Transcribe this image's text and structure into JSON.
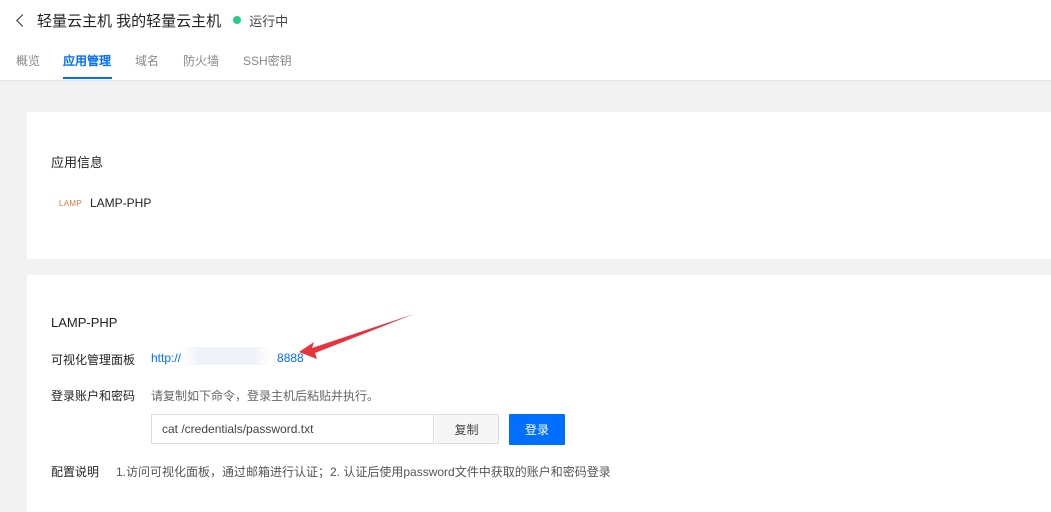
{
  "header": {
    "title": "轻量云主机 我的轻量云主机",
    "status": "运行中",
    "status_color": "#29cc85"
  },
  "tabs": [
    {
      "label": "概览",
      "active": false
    },
    {
      "label": "应用管理",
      "active": true
    },
    {
      "label": "域名",
      "active": false
    },
    {
      "label": "防火墙",
      "active": false
    },
    {
      "label": "SSH密钥",
      "active": false
    }
  ],
  "app_info": {
    "title": "应用信息",
    "logo_text": "LAMP",
    "app_name": "LAMP-PHP"
  },
  "app_detail": {
    "title": "LAMP-PHP",
    "panel_label": "可视化管理面板",
    "panel_link_prefix": "http://",
    "panel_link_suffix": "8888",
    "account_label": "登录账户和密码",
    "account_hint": "请复制如下命令，登录主机后粘贴并执行。",
    "command": "cat /credentials/password.txt",
    "copy_label": "复制",
    "login_label": "登录",
    "config_label": "配置说明",
    "config_text": "1.访问可视化面板，通过邮箱进行认证；2. 认证后使用password文件中获取的账户和密码登录"
  },
  "colors": {
    "accent": "#006eff",
    "annotation_arrow": "#e8323c"
  }
}
